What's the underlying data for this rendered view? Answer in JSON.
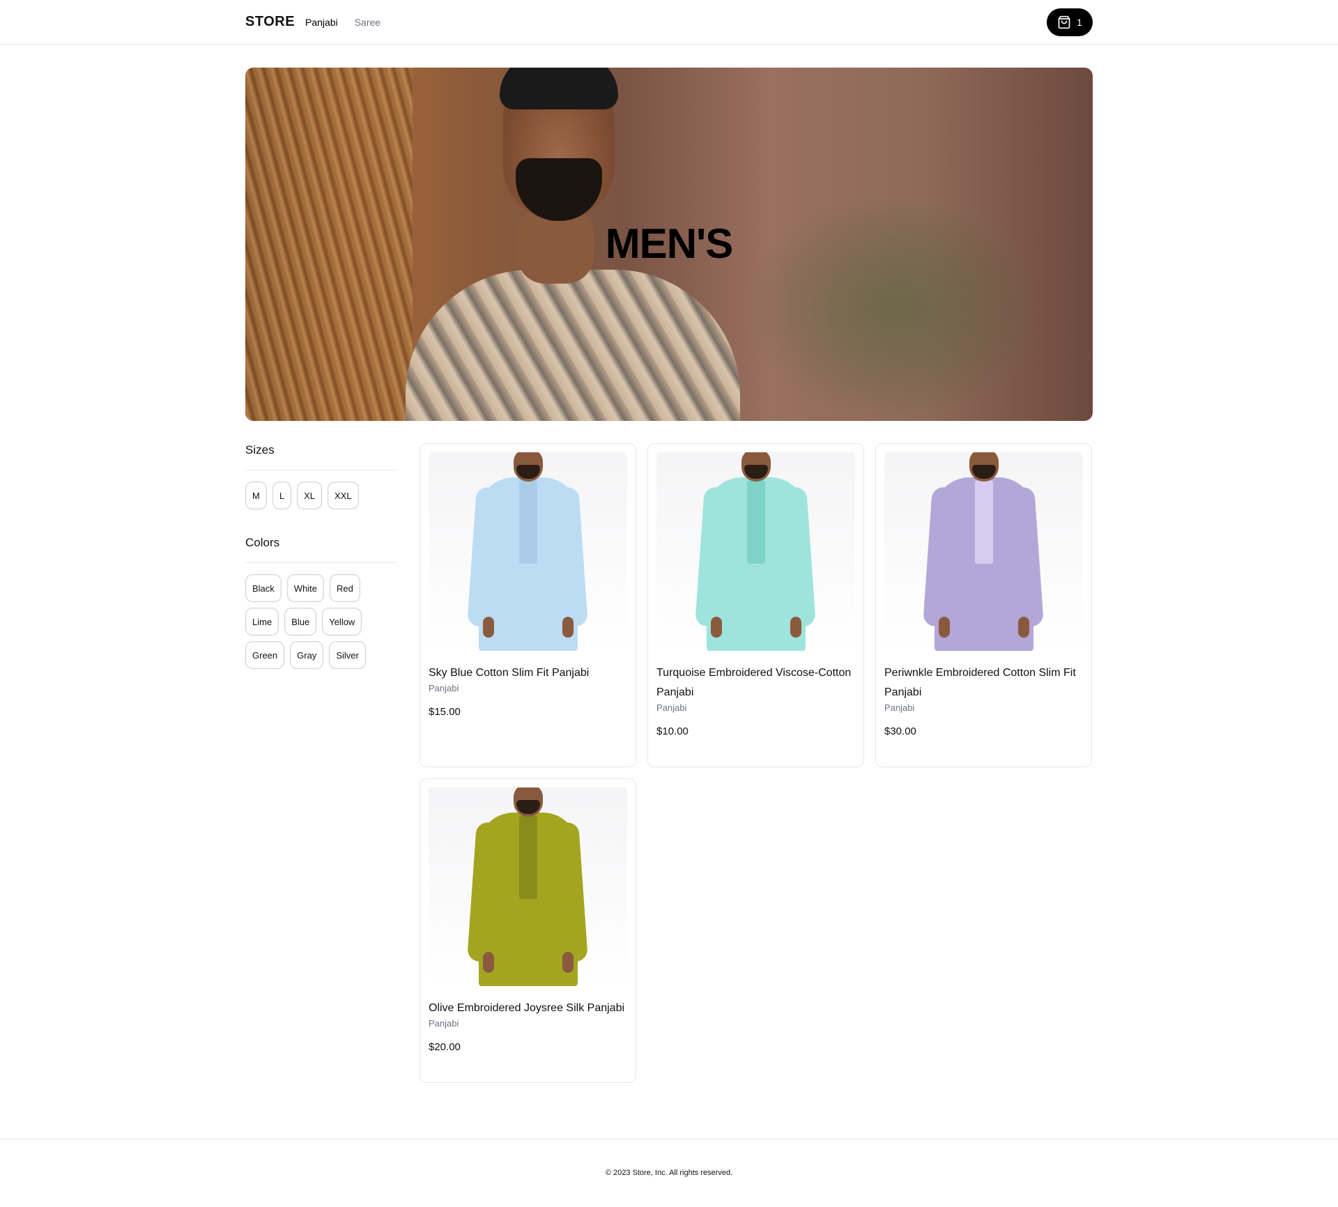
{
  "header": {
    "brand": "STORE",
    "nav": [
      {
        "label": "Panjabi",
        "active": true
      },
      {
        "label": "Saree",
        "active": false
      }
    ],
    "cart": {
      "icon": "shopping-bag-icon",
      "count": "1"
    }
  },
  "hero": {
    "title": "MEN'S"
  },
  "filters": {
    "sizes": {
      "title": "Sizes",
      "options": [
        "M",
        "L",
        "XL",
        "XXL"
      ]
    },
    "colors": {
      "title": "Colors",
      "options": [
        "Black",
        "White",
        "Red",
        "Lime",
        "Blue",
        "Yellow",
        "Green",
        "Gray",
        "Silver"
      ]
    }
  },
  "products": [
    {
      "name": "Sky Blue Cotton Slim Fit Panjabi",
      "category": "Panjabi",
      "price": "$15.00",
      "color": "#bcdcf4",
      "accent": "#a9cde9"
    },
    {
      "name": "Turquoise Embroidered Viscose-Cotton Panjabi",
      "category": "Panjabi",
      "price": "$10.00",
      "color": "#9fe4dc",
      "accent": "#7fd3c8"
    },
    {
      "name": "Periwnkle Embroidered Cotton Slim Fit Panjabi",
      "category": "Panjabi",
      "price": "$30.00",
      "color": "#b3a7d8",
      "accent": "#d6cdf0"
    },
    {
      "name": "Olive Embroidered Joysree Silk Panjabi",
      "category": "Panjabi",
      "price": "$20.00",
      "color": "#a3a521",
      "accent": "#8a8c1a"
    }
  ],
  "footer": {
    "copyright": "© 2023 Store, Inc. All rights reserved."
  }
}
